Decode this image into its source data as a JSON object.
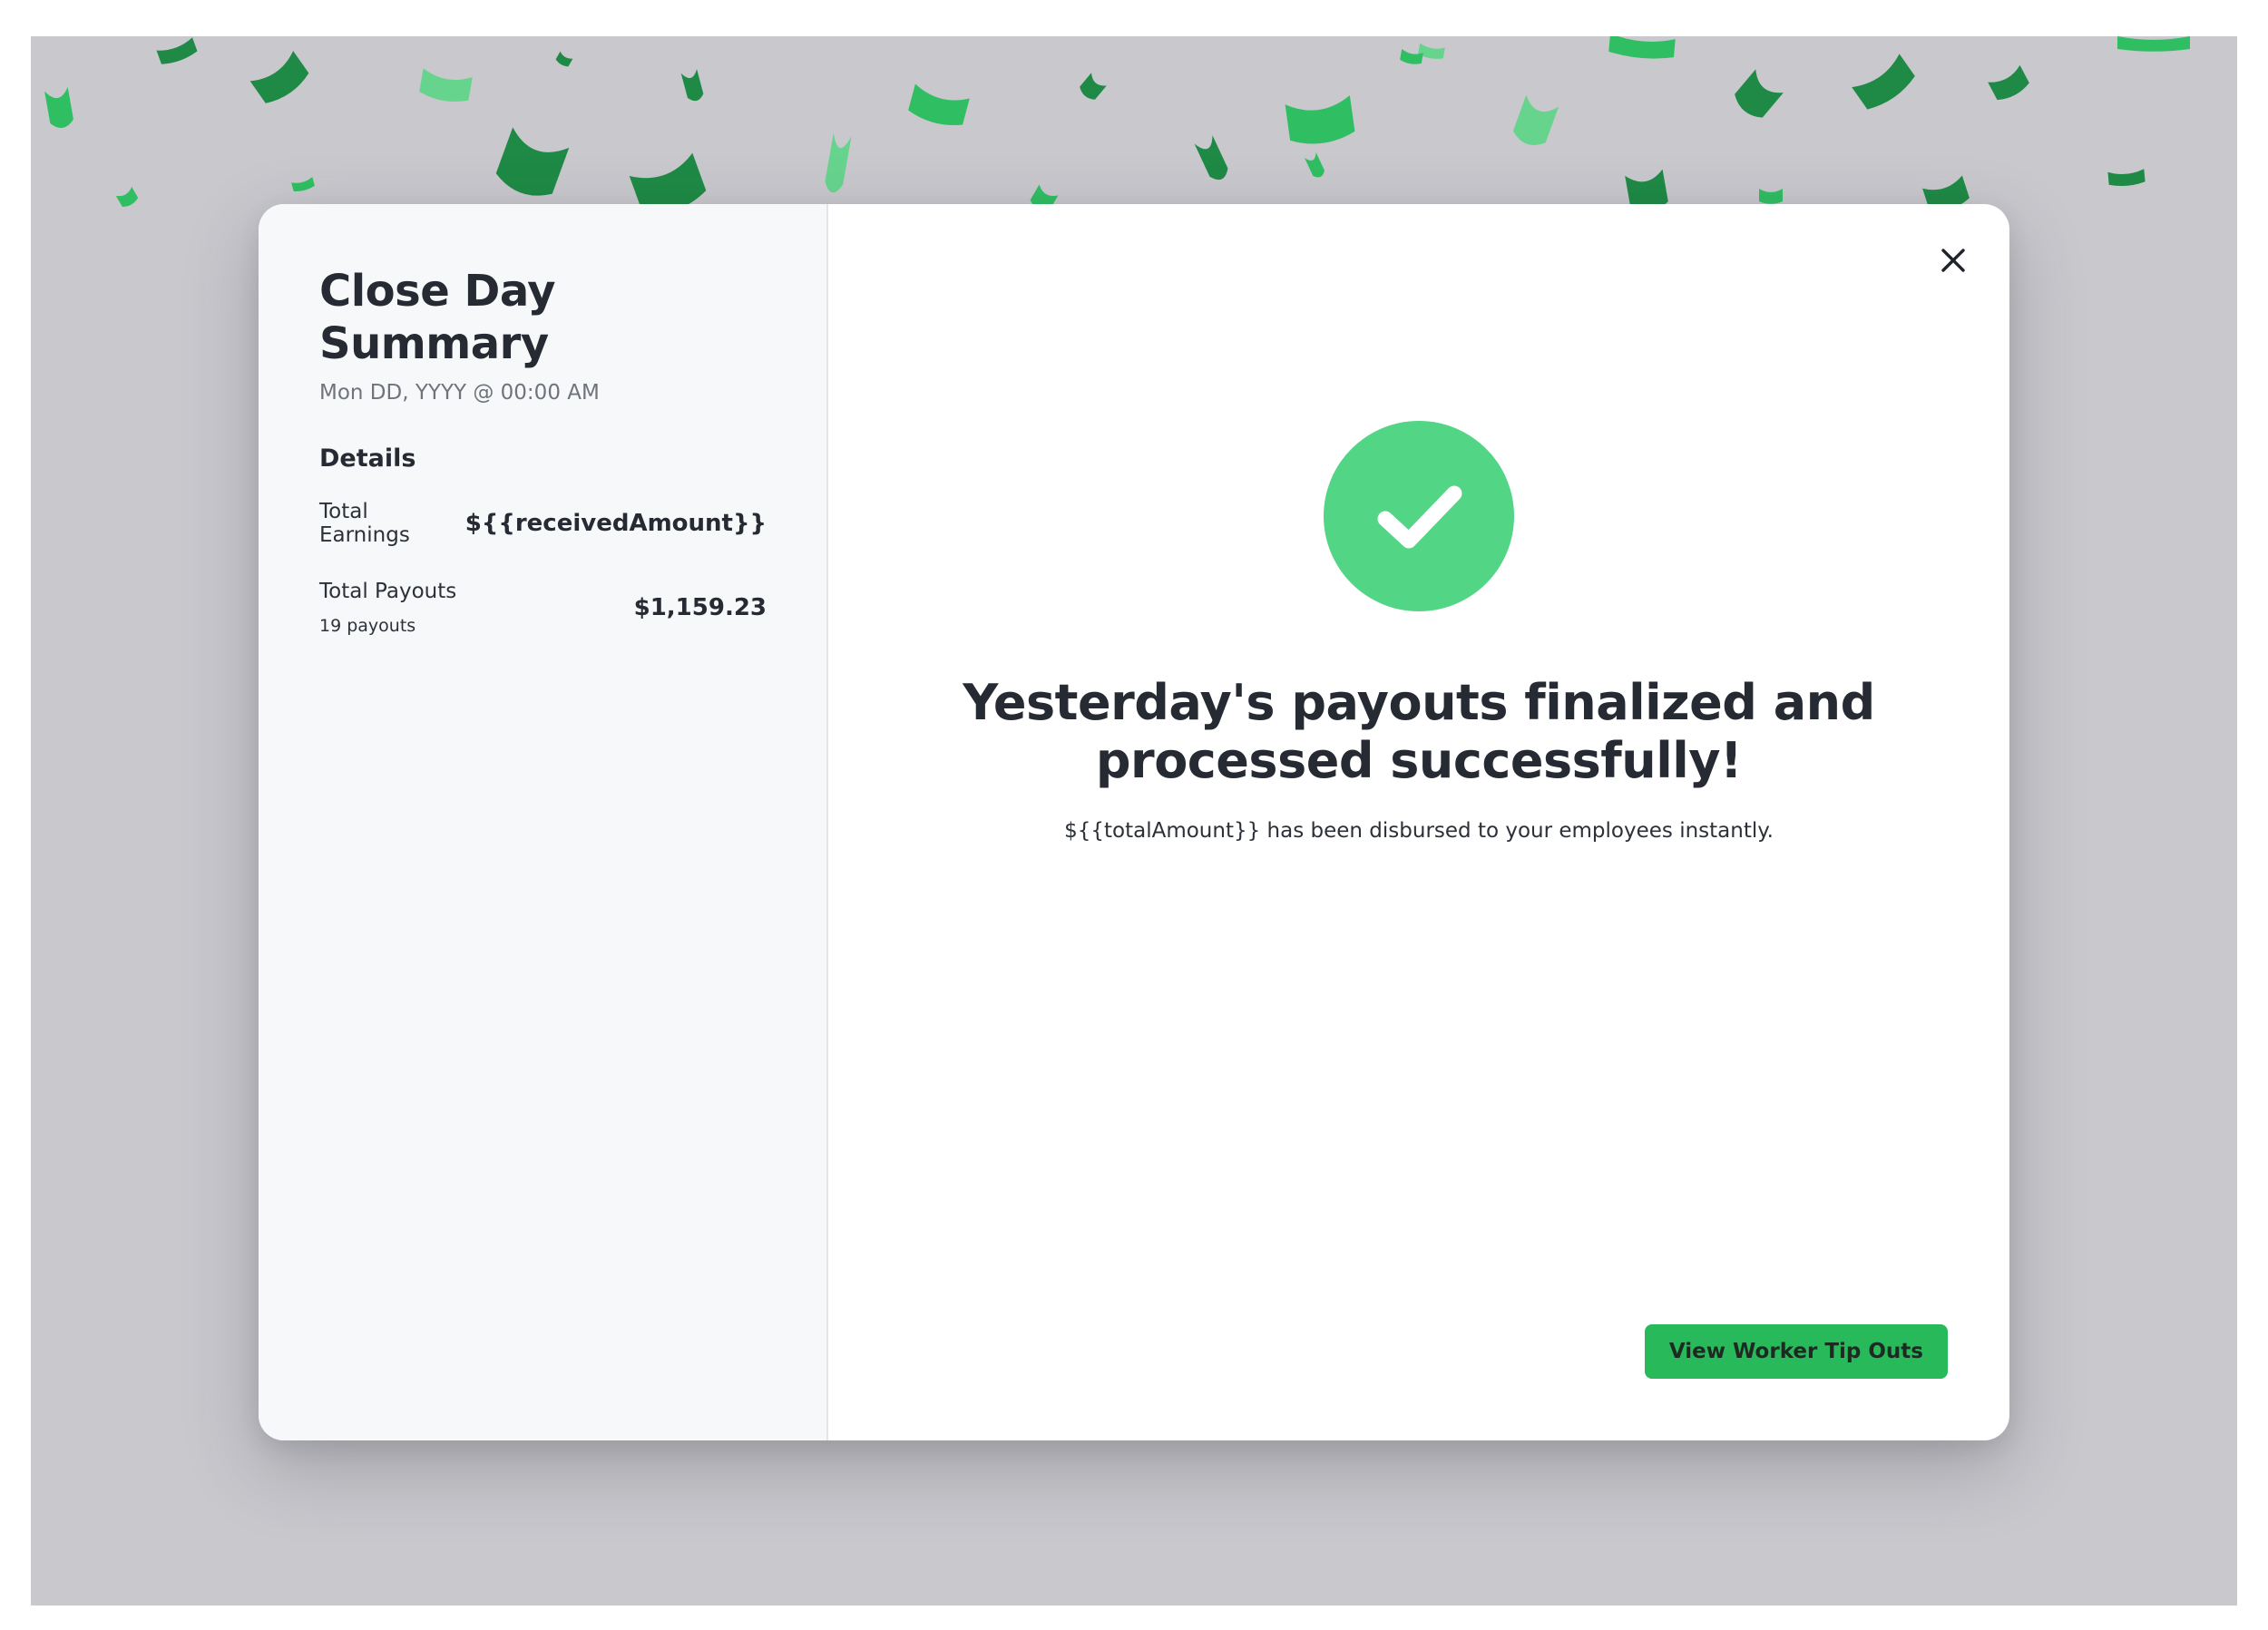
{
  "summary": {
    "title": "Close Day Summary",
    "date": "Mon DD, YYYY @ 00:00 AM",
    "details_heading": "Details",
    "rows": [
      {
        "label": "Total Earnings",
        "value": "${{receivedAmount}}"
      },
      {
        "label": "Total Payouts",
        "sub": "19 payouts",
        "value": "$1,159.23"
      }
    ]
  },
  "success": {
    "title": "Yesterday's payouts finalized and processed successfully!",
    "message": "${{totalAmount}} has been disbursed to your employees instantly."
  },
  "actions": {
    "view_tip_outs": "View Worker Tip Outs"
  },
  "icons": {
    "close": "close-icon",
    "success": "checkmark-icon",
    "confetti": "confetti-pieces"
  },
  "colors": {
    "accent_green": "#27b95a",
    "check_green": "#52d585",
    "confetti_dark": "#1e8a45",
    "confetti_mid": "#2fbf62",
    "confetti_light": "#67d48e",
    "backdrop": "#c8c8cd"
  }
}
